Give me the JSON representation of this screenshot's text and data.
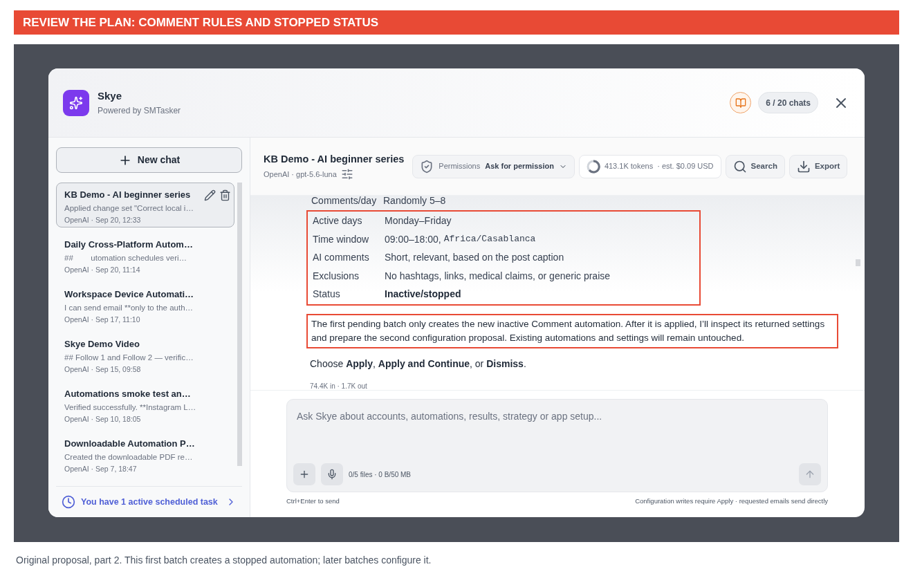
{
  "banner": {
    "title": "REVIEW THE PLAN: COMMENT RULES AND STOPPED STATUS"
  },
  "assistant": {
    "name": "Skye",
    "subtitle": "Powered by SMTasker",
    "chat_count": "6 / 20 chats"
  },
  "sidebar": {
    "new_chat": "New chat",
    "chats": [
      {
        "title": "KB Demo - AI beginner series",
        "preview": "Applied change set \"Correct local i…",
        "meta": "OpenAI · Sep 20, 12:33",
        "selected": true
      },
      {
        "title": "Daily Cross-Platform Autom…",
        "preview": "## ​ ​ ​ ​ ​ ​ ​ utomation schedules veri…",
        "meta": "OpenAI · Sep 20, 11:14",
        "selected": false
      },
      {
        "title": "Workspace Device Automati…",
        "preview": "I can send email **only to the auth…",
        "meta": "OpenAI · Sep 17, 11:10",
        "selected": false
      },
      {
        "title": "Skye Demo Video",
        "preview": "## Follow 1 and Follow 2 — verific…",
        "meta": "OpenAI · Sep 15, 09:58",
        "selected": false
      },
      {
        "title": "Automations smoke test an…",
        "preview": "Verified successfully. **Instagram L…",
        "meta": "OpenAI · Sep 10, 18:05",
        "selected": false
      },
      {
        "title": "Downloadable Automation P…",
        "preview": "Created the downloadable PDF re…",
        "meta": "OpenAI · Sep 7, 18:47",
        "selected": false
      }
    ],
    "scheduled": "You have 1 active scheduled task"
  },
  "chat_header": {
    "title": "KB Demo - AI beginner series",
    "model": "OpenAI · gpt-5.6-luna",
    "permissions_label": "Permissions",
    "permissions_value": "Ask for permission",
    "tokens": "413.1K tokens",
    "cost": "· est. $0.09 USD",
    "search": "Search",
    "export": "Export"
  },
  "message": {
    "rows": [
      {
        "label": "Comments/day",
        "value": "Randomly 5–8",
        "kind": "plain",
        "highlighted": false
      },
      {
        "label": "Active days",
        "value": "Monday–Friday",
        "kind": "plain",
        "highlighted": true
      },
      {
        "label": "Time window",
        "value": "09:00–18:00,",
        "code": "Africa/Casablanca",
        "kind": "code",
        "highlighted": true
      },
      {
        "label": "AI comments",
        "value": "Short, relevant, based on the post caption",
        "kind": "plain",
        "highlighted": true
      },
      {
        "label": "Exclusions",
        "value": "No hashtags, links, medical claims, or generic praise",
        "kind": "plain",
        "highlighted": true
      },
      {
        "label": "Status",
        "value": "Inactive/stopped",
        "kind": "bold",
        "highlighted": true
      }
    ],
    "note": "The first pending batch only creates the new inactive Comment automation. After it is applied, I’ll inspect its returned settings and prepare the second configuration proposal. Existing automations and settings will remain untouched.",
    "note_highlighted": true,
    "choose": "Choose **Apply**, **Apply and Continue**, or **Dismiss**.",
    "usage": "74.4K in · 1.7K out"
  },
  "composer": {
    "placeholder": "Ask Skye about accounts, automations, results, strategy or app setup...",
    "files": "0/5 files · 0 B/50 MB",
    "hint_left": "Ctrl+Enter to send",
    "hint_right": "Configuration writes require Apply · requested emails send directly"
  },
  "caption": "Original proposal, part 2. This first batch creates a stopped automation; later batches configure it."
}
